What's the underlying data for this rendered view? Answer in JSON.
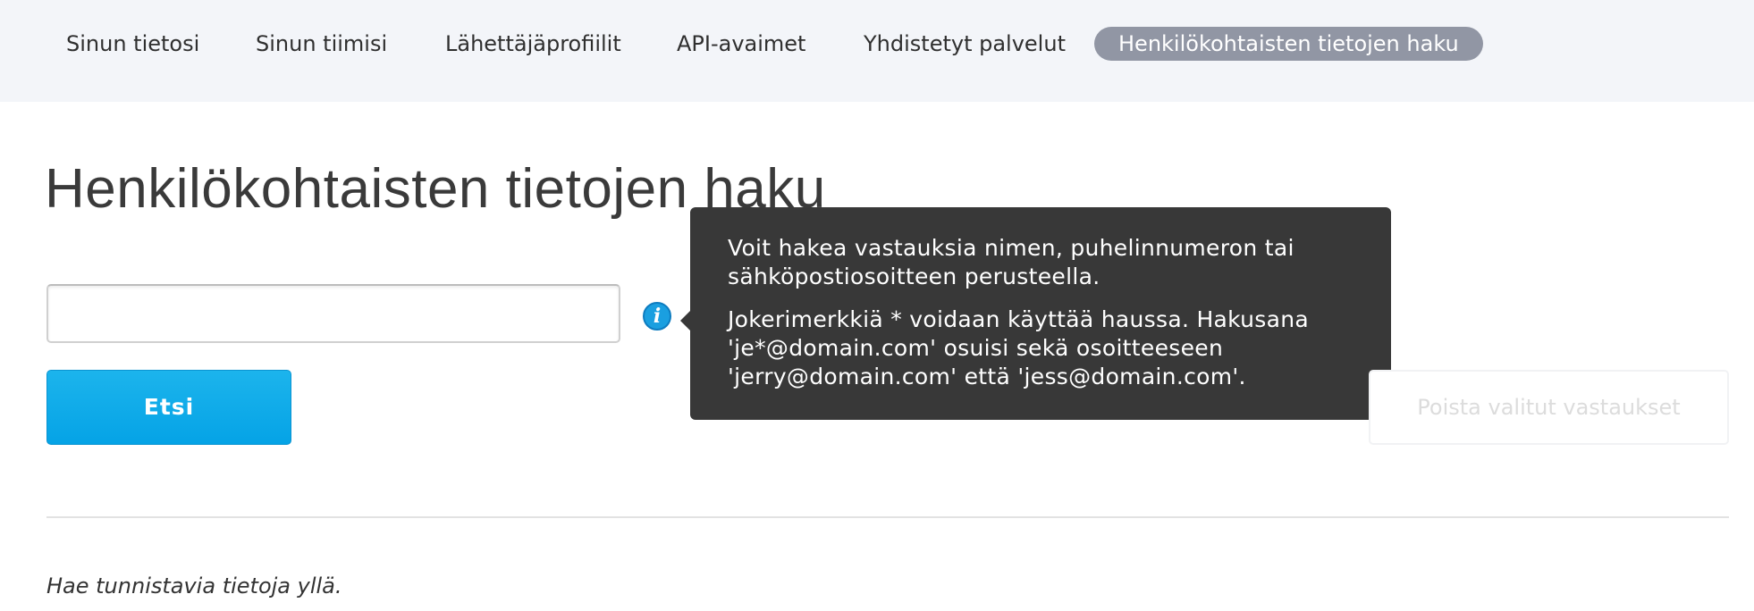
{
  "nav": {
    "tabs": [
      {
        "label": "Sinun tietosi"
      },
      {
        "label": "Sinun tiimisi"
      },
      {
        "label": "Lähettäjäprofiilit"
      },
      {
        "label": "API-avaimet"
      },
      {
        "label": "Yhdistetyt palvelut"
      },
      {
        "label": "Henkilökohtaisten tietojen haku",
        "active": true
      }
    ]
  },
  "main": {
    "title": "Henkilökohtaisten tietojen haku",
    "search": {
      "value": "",
      "placeholder": ""
    },
    "info_icon": {
      "icon": "info-icon"
    },
    "tooltip": {
      "paragraph1": "Voit hakea vastauksia nimen, puhelinnumeron tai sähköpostiosoitteen perusteella.",
      "paragraph2": "Jokerimerkkiä * voidaan käyttää haussa. Hakusana 'je*@domain.com' osuisi sekä osoitteeseen 'jerry@domain.com' että 'jess@domain.com'."
    },
    "search_button": "Etsi",
    "delete_button": "Poista valitut vastaukset",
    "hint": "Hae tunnistavia tietoja yllä."
  },
  "colors": {
    "nav_background": "#f3f5f9",
    "active_tab": "#9196a4",
    "primary_button": "#0aa9ea",
    "tooltip_background": "#383838",
    "info_icon": "#1a9fe0"
  }
}
